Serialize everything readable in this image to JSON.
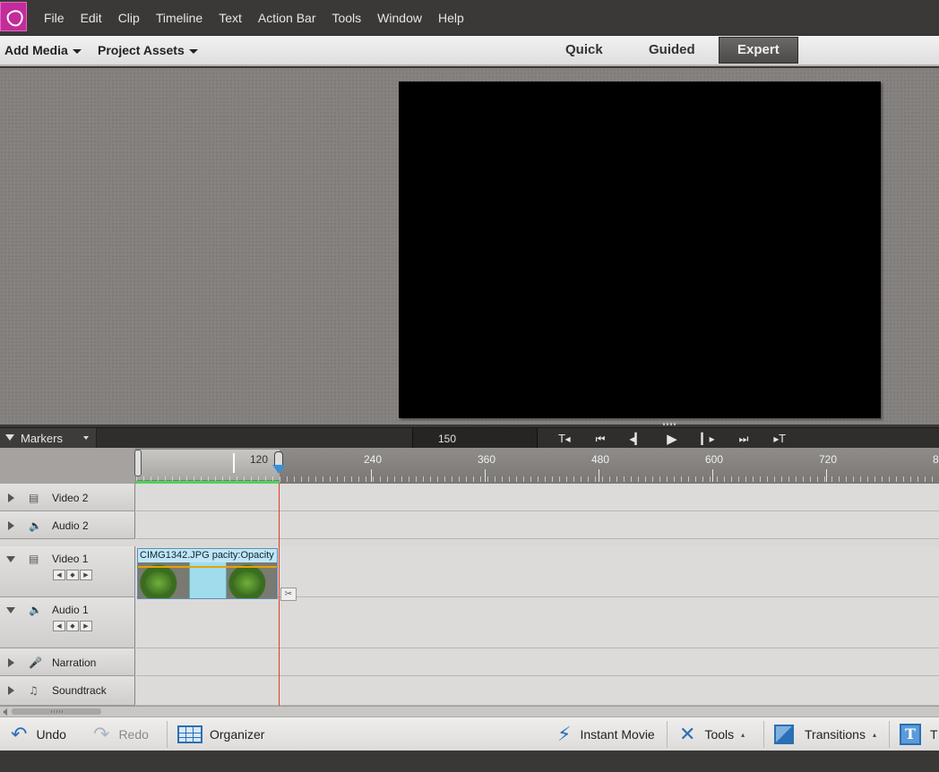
{
  "menubar": {
    "items": [
      "File",
      "Edit",
      "Clip",
      "Timeline",
      "Text",
      "Action Bar",
      "Tools",
      "Window",
      "Help"
    ]
  },
  "topbar": {
    "add_media": "Add Media",
    "project_assets": "Project Assets",
    "modes": [
      "Quick",
      "Guided",
      "Expert"
    ],
    "active_mode": "Expert"
  },
  "timeline_bar": {
    "markers_label": "Markers",
    "timecode": "150",
    "transport_icons": [
      "go-to-in-icon",
      "go-to-start-icon",
      "step-back-icon",
      "play-icon",
      "step-forward-icon",
      "go-to-end-icon",
      "go-to-out-icon"
    ]
  },
  "ruler": {
    "labels": [
      "120",
      "240",
      "360",
      "480",
      "600",
      "720",
      "8"
    ]
  },
  "tracks": [
    {
      "name": "Video 2",
      "icon": "film-icon",
      "expanded": false
    },
    {
      "name": "Audio 2",
      "icon": "speaker-icon",
      "expanded": false
    },
    {
      "name": "Video 1",
      "icon": "film-icon",
      "expanded": true
    },
    {
      "name": "Audio 1",
      "icon": "speaker-icon",
      "expanded": true
    },
    {
      "name": "Narration",
      "icon": "microphone-icon",
      "expanded": false
    },
    {
      "name": "Soundtrack",
      "icon": "music-note-icon",
      "expanded": false
    }
  ],
  "clip": {
    "title": "CIMG1342.JPG pacity:Opacity"
  },
  "actionbar": {
    "undo": "Undo",
    "redo": "Redo",
    "organizer": "Organizer",
    "instant_movie": "Instant Movie",
    "tools": "Tools",
    "transitions": "Transitions",
    "titles": "T"
  },
  "colors": {
    "app_icon": "#c32c9a",
    "accent_blue": "#2b6fb4",
    "playhead_line": "#e23a2f",
    "work_area_bar": "#4bd35a",
    "opacity_line": "#e5a300"
  }
}
